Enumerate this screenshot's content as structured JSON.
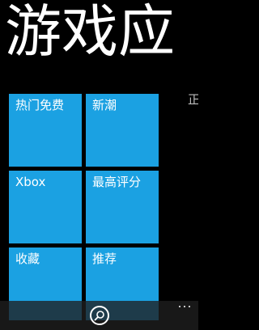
{
  "hub": {
    "title": "游戏应",
    "peek_label": "正"
  },
  "tiles": [
    {
      "label": "热门免费"
    },
    {
      "label": "新潮"
    },
    {
      "label": "Xbox"
    },
    {
      "label": "最高评分"
    },
    {
      "label": "收藏"
    },
    {
      "label": "推荐"
    }
  ],
  "colors": {
    "background": "#000000",
    "tile": "#1ba1e2",
    "text": "#ffffff",
    "app_bar": "#1f1f1f"
  },
  "app_bar": {
    "icons": [
      "search-icon",
      "more-icon"
    ]
  }
}
